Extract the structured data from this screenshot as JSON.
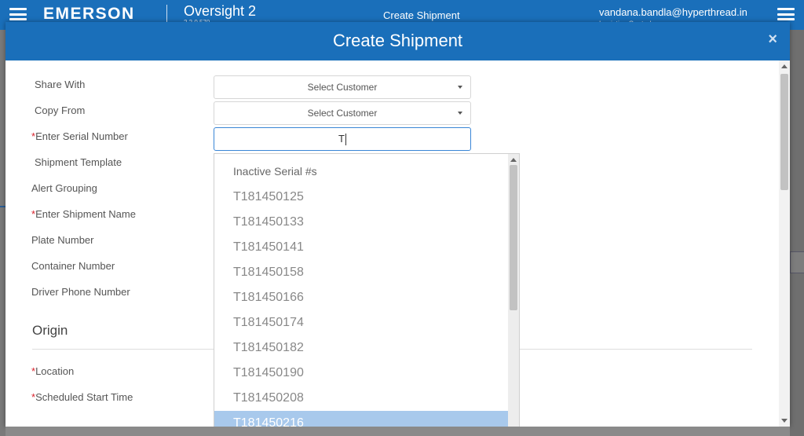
{
  "app": {
    "brand": "EMERSON",
    "product": "Oversight 2",
    "version": "2.2.0.570",
    "page_name": "Create Shipment",
    "user_email": "vandana.bandla@hyperthread.in",
    "user_sub": "Logistics Central"
  },
  "modal": {
    "title": "Create Shipment",
    "close_label": "×"
  },
  "form": {
    "share_with": {
      "label": "Share With",
      "value": "Select Customer"
    },
    "copy_from": {
      "label": "Copy From",
      "value": "Select Customer"
    },
    "serial_number": {
      "required_mark": "*",
      "label": "Enter Serial Number",
      "value": "T"
    },
    "shipment_template": {
      "label": "Shipment Template"
    },
    "alert_grouping": {
      "label": "Alert Grouping"
    },
    "shipment_name": {
      "required_mark": "*",
      "label": "Enter Shipment Name"
    },
    "plate_number": {
      "label": "Plate Number"
    },
    "container_number": {
      "label": "Container Number"
    },
    "driver_phone": {
      "label": "Driver Phone Number"
    },
    "origin_section": {
      "title": "Origin"
    },
    "location": {
      "required_mark": "*",
      "label": "Location"
    },
    "scheduled_start": {
      "required_mark": "*",
      "label": "Scheduled Start Time"
    }
  },
  "dropdown": {
    "header": "Inactive Serial #s",
    "items": [
      "T181450125",
      "T181450133",
      "T181450141",
      "T181450158",
      "T181450166",
      "T181450174",
      "T181450182",
      "T181450190",
      "T181450208",
      "T181450216"
    ],
    "highlighted_index": 9
  },
  "colors": {
    "brand_blue": "#1a6fba",
    "required_red": "#d9232d",
    "highlight": "#a8c9ec"
  },
  "icons": {
    "menu": "hamburger-icon",
    "close": "close-icon",
    "dropdown": "caret-down-icon"
  }
}
